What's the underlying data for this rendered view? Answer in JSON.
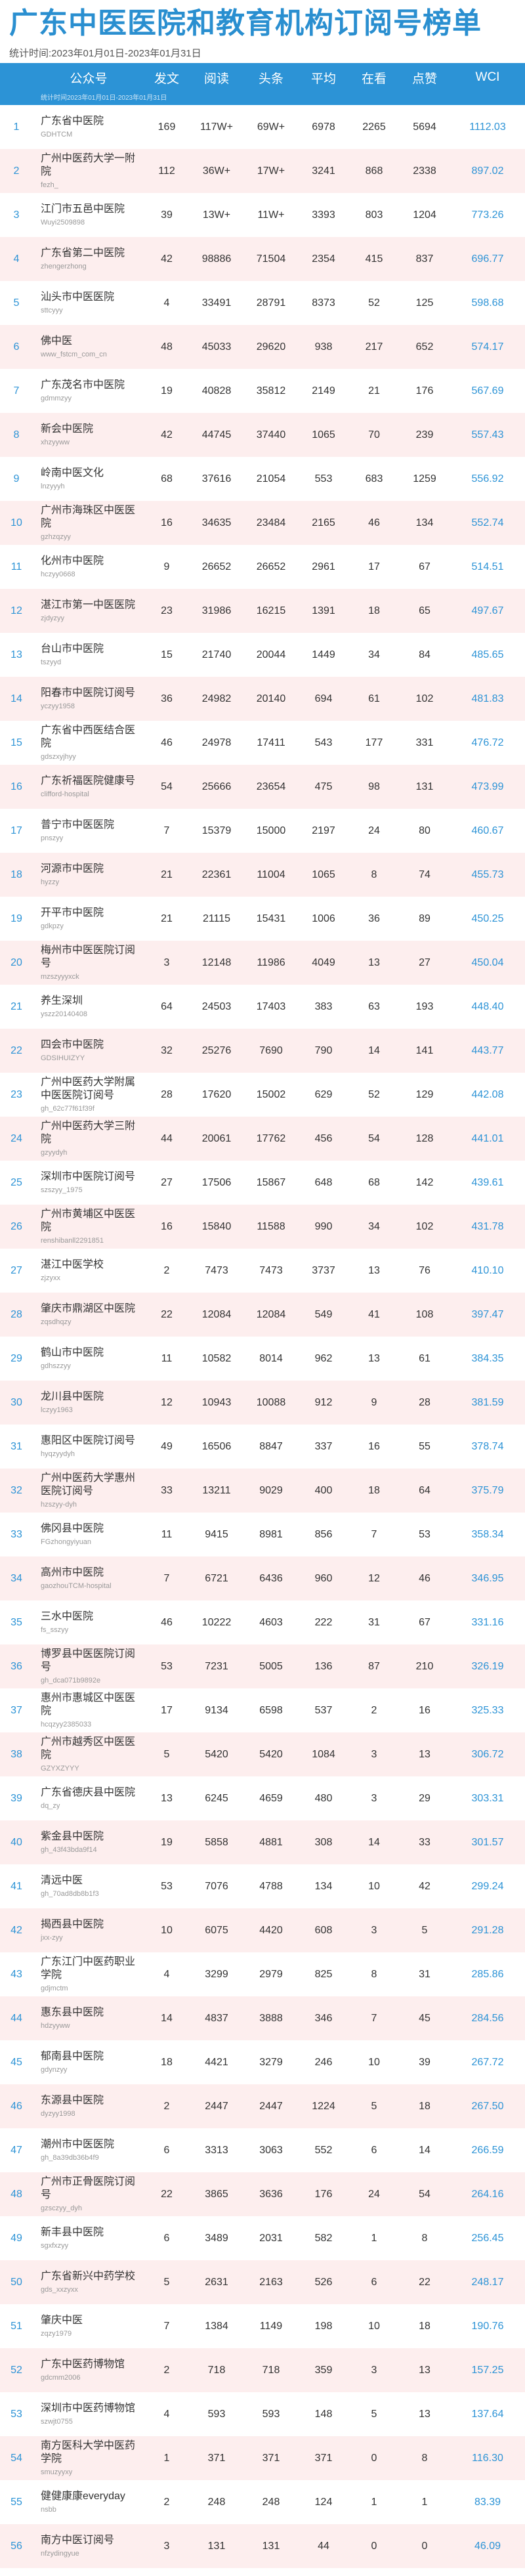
{
  "title": "广东中医医院和教育机构订阅号榜单",
  "stat_range": "统计时间:2023年01月01日-2023年01月31日",
  "subheader_note": "统计时间2023年01月01日-2023年01月31日",
  "columns": {
    "name": "公众号",
    "posts": "发文",
    "reads": "阅读",
    "head": "头条",
    "avg": "平均",
    "look": "在看",
    "like": "点赞",
    "wci": "WCI"
  },
  "rows": [
    {
      "rank": "1",
      "name": "广东省中医院",
      "id": "GDHTCM",
      "posts": "169",
      "reads": "117W+",
      "head": "69W+",
      "avg": "6978",
      "look": "2265",
      "like": "5694",
      "wci": "1112.03"
    },
    {
      "rank": "2",
      "name": "广州中医药大学一附院",
      "id": "fezh_",
      "posts": "112",
      "reads": "36W+",
      "head": "17W+",
      "avg": "3241",
      "look": "868",
      "like": "2338",
      "wci": "897.02"
    },
    {
      "rank": "3",
      "name": "江门市五邑中医院",
      "id": "Wuyi2509898",
      "posts": "39",
      "reads": "13W+",
      "head": "11W+",
      "avg": "3393",
      "look": "803",
      "like": "1204",
      "wci": "773.26"
    },
    {
      "rank": "4",
      "name": "广东省第二中医院",
      "id": "zhengerzhong",
      "posts": "42",
      "reads": "98886",
      "head": "71504",
      "avg": "2354",
      "look": "415",
      "like": "837",
      "wci": "696.77"
    },
    {
      "rank": "5",
      "name": "汕头市中医医院",
      "id": "sttcyyy",
      "posts": "4",
      "reads": "33491",
      "head": "28791",
      "avg": "8373",
      "look": "52",
      "like": "125",
      "wci": "598.68"
    },
    {
      "rank": "6",
      "name": "佛中医",
      "id": "www_fstcm_com_cn",
      "posts": "48",
      "reads": "45033",
      "head": "29620",
      "avg": "938",
      "look": "217",
      "like": "652",
      "wci": "574.17"
    },
    {
      "rank": "7",
      "name": "广东茂名市中医院",
      "id": "gdmmzyy",
      "posts": "19",
      "reads": "40828",
      "head": "35812",
      "avg": "2149",
      "look": "21",
      "like": "176",
      "wci": "567.69"
    },
    {
      "rank": "8",
      "name": "新会中医院",
      "id": "xhzyyww",
      "posts": "42",
      "reads": "44745",
      "head": "37440",
      "avg": "1065",
      "look": "70",
      "like": "239",
      "wci": "557.43"
    },
    {
      "rank": "9",
      "name": "岭南中医文化",
      "id": "lnzyyyh",
      "posts": "68",
      "reads": "37616",
      "head": "21054",
      "avg": "553",
      "look": "683",
      "like": "1259",
      "wci": "556.92"
    },
    {
      "rank": "10",
      "name": "广州市海珠区中医医院",
      "id": "gzhzqzyy",
      "posts": "16",
      "reads": "34635",
      "head": "23484",
      "avg": "2165",
      "look": "46",
      "like": "134",
      "wci": "552.74"
    },
    {
      "rank": "11",
      "name": "化州市中医院",
      "id": "hczyy0668",
      "posts": "9",
      "reads": "26652",
      "head": "26652",
      "avg": "2961",
      "look": "17",
      "like": "67",
      "wci": "514.51"
    },
    {
      "rank": "12",
      "name": "湛江市第一中医医院",
      "id": "zjdyzyy",
      "posts": "23",
      "reads": "31986",
      "head": "16215",
      "avg": "1391",
      "look": "18",
      "like": "65",
      "wci": "497.67"
    },
    {
      "rank": "13",
      "name": "台山市中医院",
      "id": "tszyyd",
      "posts": "15",
      "reads": "21740",
      "head": "20044",
      "avg": "1449",
      "look": "34",
      "like": "84",
      "wci": "485.65"
    },
    {
      "rank": "14",
      "name": "阳春市中医院订阅号",
      "id": "yczyy1958",
      "posts": "36",
      "reads": "24982",
      "head": "20140",
      "avg": "694",
      "look": "61",
      "like": "102",
      "wci": "481.83"
    },
    {
      "rank": "15",
      "name": "广东省中西医结合医院",
      "id": "gdszxyjhyy",
      "posts": "46",
      "reads": "24978",
      "head": "17411",
      "avg": "543",
      "look": "177",
      "like": "331",
      "wci": "476.72"
    },
    {
      "rank": "16",
      "name": "广东祈福医院健康号",
      "id": "clifford-hospital",
      "posts": "54",
      "reads": "25666",
      "head": "23654",
      "avg": "475",
      "look": "98",
      "like": "131",
      "wci": "473.99"
    },
    {
      "rank": "17",
      "name": "普宁市中医医院",
      "id": "pnszyy",
      "posts": "7",
      "reads": "15379",
      "head": "15000",
      "avg": "2197",
      "look": "24",
      "like": "80",
      "wci": "460.67"
    },
    {
      "rank": "18",
      "name": "河源市中医院",
      "id": "hyzzy",
      "posts": "21",
      "reads": "22361",
      "head": "11004",
      "avg": "1065",
      "look": "8",
      "like": "74",
      "wci": "455.73"
    },
    {
      "rank": "19",
      "name": "开平市中医院",
      "id": "gdkpzy",
      "posts": "21",
      "reads": "21115",
      "head": "15431",
      "avg": "1006",
      "look": "36",
      "like": "89",
      "wci": "450.25"
    },
    {
      "rank": "20",
      "name": "梅州市中医医院订阅号",
      "id": "mzszyyyxck",
      "posts": "3",
      "reads": "12148",
      "head": "11986",
      "avg": "4049",
      "look": "13",
      "like": "27",
      "wci": "450.04"
    },
    {
      "rank": "21",
      "name": "养生深圳",
      "id": "yszz20140408",
      "posts": "64",
      "reads": "24503",
      "head": "17403",
      "avg": "383",
      "look": "63",
      "like": "193",
      "wci": "448.40"
    },
    {
      "rank": "22",
      "name": "四会市中医院",
      "id": "GDSIHUIZYY",
      "posts": "32",
      "reads": "25276",
      "head": "7690",
      "avg": "790",
      "look": "14",
      "like": "141",
      "wci": "443.77"
    },
    {
      "rank": "23",
      "name": "广州中医药大学附属中医医院订阅号",
      "id": "gh_62c77f61f39f",
      "posts": "28",
      "reads": "17620",
      "head": "15002",
      "avg": "629",
      "look": "52",
      "like": "129",
      "wci": "442.08"
    },
    {
      "rank": "24",
      "name": "广州中医药大学三附院",
      "id": "gzyydyh",
      "posts": "44",
      "reads": "20061",
      "head": "17762",
      "avg": "456",
      "look": "54",
      "like": "128",
      "wci": "441.01"
    },
    {
      "rank": "25",
      "name": "深圳市中医院订阅号",
      "id": "szszyy_1975",
      "posts": "27",
      "reads": "17506",
      "head": "15867",
      "avg": "648",
      "look": "68",
      "like": "142",
      "wci": "439.61"
    },
    {
      "rank": "26",
      "name": "广州市黄埔区中医医院",
      "id": "renshibanll2291851",
      "posts": "16",
      "reads": "15840",
      "head": "11588",
      "avg": "990",
      "look": "34",
      "like": "102",
      "wci": "431.78"
    },
    {
      "rank": "27",
      "name": "湛江中医学校",
      "id": "zjzyxx",
      "posts": "2",
      "reads": "7473",
      "head": "7473",
      "avg": "3737",
      "look": "13",
      "like": "76",
      "wci": "410.10"
    },
    {
      "rank": "28",
      "name": "肇庆市鼎湖区中医院",
      "id": "zqsdhqzy",
      "posts": "22",
      "reads": "12084",
      "head": "12084",
      "avg": "549",
      "look": "41",
      "like": "108",
      "wci": "397.47"
    },
    {
      "rank": "29",
      "name": "鹤山市中医院",
      "id": "gdhszzyy",
      "posts": "11",
      "reads": "10582",
      "head": "8014",
      "avg": "962",
      "look": "13",
      "like": "61",
      "wci": "384.35"
    },
    {
      "rank": "30",
      "name": "龙川县中医院",
      "id": "lczyy1963",
      "posts": "12",
      "reads": "10943",
      "head": "10088",
      "avg": "912",
      "look": "9",
      "like": "28",
      "wci": "381.59"
    },
    {
      "rank": "31",
      "name": "惠阳区中医院订阅号",
      "id": "hyqzyydyh",
      "posts": "49",
      "reads": "16506",
      "head": "8847",
      "avg": "337",
      "look": "16",
      "like": "55",
      "wci": "378.74"
    },
    {
      "rank": "32",
      "name": "广州中医药大学惠州医院订阅号",
      "id": "hzszyy-dyh",
      "posts": "33",
      "reads": "13211",
      "head": "9029",
      "avg": "400",
      "look": "18",
      "like": "64",
      "wci": "375.79"
    },
    {
      "rank": "33",
      "name": "佛冈县中医院",
      "id": "FGzhongyiyuan",
      "posts": "11",
      "reads": "9415",
      "head": "8981",
      "avg": "856",
      "look": "7",
      "like": "53",
      "wci": "358.34"
    },
    {
      "rank": "34",
      "name": "高州市中医院",
      "id": "gaozhouTCM-hospital",
      "posts": "7",
      "reads": "6721",
      "head": "6436",
      "avg": "960",
      "look": "12",
      "like": "46",
      "wci": "346.95"
    },
    {
      "rank": "35",
      "name": "三水中医院",
      "id": "fs_sszyy",
      "posts": "46",
      "reads": "10222",
      "head": "4603",
      "avg": "222",
      "look": "31",
      "like": "67",
      "wci": "331.16"
    },
    {
      "rank": "36",
      "name": "博罗县中医医院订阅号",
      "id": "gh_dca071b9892e",
      "posts": "53",
      "reads": "7231",
      "head": "5005",
      "avg": "136",
      "look": "87",
      "like": "210",
      "wci": "326.19"
    },
    {
      "rank": "37",
      "name": "惠州市惠城区中医医院",
      "id": "hcqzyy2385033",
      "posts": "17",
      "reads": "9134",
      "head": "6598",
      "avg": "537",
      "look": "2",
      "like": "16",
      "wci": "325.33"
    },
    {
      "rank": "38",
      "name": "广州市越秀区中医医院",
      "id": "GZYXZYYY",
      "posts": "5",
      "reads": "5420",
      "head": "5420",
      "avg": "1084",
      "look": "3",
      "like": "13",
      "wci": "306.72"
    },
    {
      "rank": "39",
      "name": "广东省德庆县中医院",
      "id": "dq_zy",
      "posts": "13",
      "reads": "6245",
      "head": "4659",
      "avg": "480",
      "look": "3",
      "like": "29",
      "wci": "303.31"
    },
    {
      "rank": "40",
      "name": "紫金县中医院",
      "id": "gh_43f43bda9f14",
      "posts": "19",
      "reads": "5858",
      "head": "4881",
      "avg": "308",
      "look": "14",
      "like": "33",
      "wci": "301.57"
    },
    {
      "rank": "41",
      "name": "清远中医",
      "id": "gh_70ad8db8b1f3",
      "posts": "53",
      "reads": "7076",
      "head": "4788",
      "avg": "134",
      "look": "10",
      "like": "42",
      "wci": "299.24"
    },
    {
      "rank": "42",
      "name": "揭西县中医院",
      "id": "jxx-zyy",
      "posts": "10",
      "reads": "6075",
      "head": "4420",
      "avg": "608",
      "look": "3",
      "like": "5",
      "wci": "291.28"
    },
    {
      "rank": "43",
      "name": "广东江门中医药职业学院",
      "id": "gdjmctm",
      "posts": "4",
      "reads": "3299",
      "head": "2979",
      "avg": "825",
      "look": "8",
      "like": "31",
      "wci": "285.86"
    },
    {
      "rank": "44",
      "name": "惠东县中医院",
      "id": "hdzyyww",
      "posts": "14",
      "reads": "4837",
      "head": "3888",
      "avg": "346",
      "look": "7",
      "like": "45",
      "wci": "284.56"
    },
    {
      "rank": "45",
      "name": "郁南县中医院",
      "id": "gdynzyy",
      "posts": "18",
      "reads": "4421",
      "head": "3279",
      "avg": "246",
      "look": "10",
      "like": "39",
      "wci": "267.72"
    },
    {
      "rank": "46",
      "name": "东源县中医院",
      "id": "dyzyy1998",
      "posts": "2",
      "reads": "2447",
      "head": "2447",
      "avg": "1224",
      "look": "5",
      "like": "18",
      "wci": "267.50"
    },
    {
      "rank": "47",
      "name": "潮州市中医医院",
      "id": "gh_8a39db36b4f9",
      "posts": "6",
      "reads": "3313",
      "head": "3063",
      "avg": "552",
      "look": "6",
      "like": "14",
      "wci": "266.59"
    },
    {
      "rank": "48",
      "name": "广州市正骨医院订阅号",
      "id": "gzsczyy_dyh",
      "posts": "22",
      "reads": "3865",
      "head": "3636",
      "avg": "176",
      "look": "24",
      "like": "54",
      "wci": "264.16"
    },
    {
      "rank": "49",
      "name": "新丰县中医院",
      "id": "sgxfxzyy",
      "posts": "6",
      "reads": "3489",
      "head": "2031",
      "avg": "582",
      "look": "1",
      "like": "8",
      "wci": "256.45"
    },
    {
      "rank": "50",
      "name": "广东省新兴中药学校",
      "id": "gds_xxzyxx",
      "posts": "5",
      "reads": "2631",
      "head": "2163",
      "avg": "526",
      "look": "6",
      "like": "22",
      "wci": "248.17"
    },
    {
      "rank": "51",
      "name": "肇庆中医",
      "id": "zqzy1979",
      "posts": "7",
      "reads": "1384",
      "head": "1149",
      "avg": "198",
      "look": "10",
      "like": "18",
      "wci": "190.76"
    },
    {
      "rank": "52",
      "name": "广东中医药博物馆",
      "id": "gdcmm2006",
      "posts": "2",
      "reads": "718",
      "head": "718",
      "avg": "359",
      "look": "3",
      "like": "13",
      "wci": "157.25"
    },
    {
      "rank": "53",
      "name": "深圳市中医药博物馆",
      "id": "szwjt0755",
      "posts": "4",
      "reads": "593",
      "head": "593",
      "avg": "148",
      "look": "5",
      "like": "13",
      "wci": "137.64"
    },
    {
      "rank": "54",
      "name": "南方医科大学中医药学院",
      "id": "smuzyyxy",
      "posts": "1",
      "reads": "371",
      "head": "371",
      "avg": "371",
      "look": "0",
      "like": "8",
      "wci": "116.30"
    },
    {
      "rank": "55",
      "name": "健健康康everyday",
      "id": "nsbb",
      "posts": "2",
      "reads": "248",
      "head": "248",
      "avg": "124",
      "look": "1",
      "like": "1",
      "wci": "83.39"
    },
    {
      "rank": "56",
      "name": "南方中医订阅号",
      "id": "nfzydingyue",
      "posts": "3",
      "reads": "131",
      "head": "131",
      "avg": "44",
      "look": "0",
      "like": "0",
      "wci": "46.09"
    }
  ]
}
